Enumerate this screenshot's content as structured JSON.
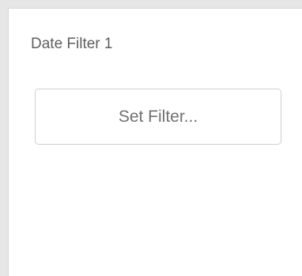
{
  "filter_panel": {
    "title": "Date Filter 1",
    "set_filter_label": "Set Filter..."
  }
}
